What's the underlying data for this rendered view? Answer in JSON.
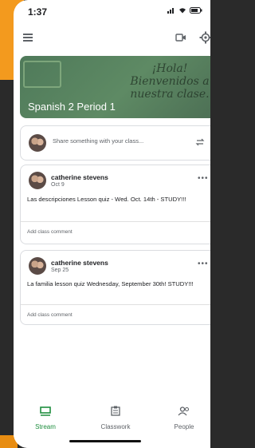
{
  "status_bar": {
    "time": "1:37"
  },
  "course": {
    "title": "Spanish 2 Period 1",
    "banner_text": "¡Hola! Bienvenidos a nuestra clase."
  },
  "share": {
    "placeholder": "Share something with your class..."
  },
  "posts": [
    {
      "author": "catherine stevens",
      "date": "Oct 9",
      "text": "Las descripciones Lesson quiz - Wed. Oct. 14th - STUDY!!!",
      "comment_placeholder": "Add class comment"
    },
    {
      "author": "catherine stevens",
      "date": "Sep 25",
      "text": "La familia lesson quiz Wednesday, September 30th! STUDY!!!",
      "comment_placeholder": "Add class comment"
    }
  ],
  "nav": {
    "items": [
      {
        "label": "Stream"
      },
      {
        "label": "Classwork"
      },
      {
        "label": "People"
      }
    ]
  },
  "colors": {
    "accent": "#1e8e3e",
    "banner": "#5e8a64"
  },
  "icons": [
    "menu-icon",
    "video-icon",
    "gear-icon",
    "repost-icon",
    "more-icon",
    "stream-icon",
    "classwork-icon",
    "people-icon"
  ]
}
